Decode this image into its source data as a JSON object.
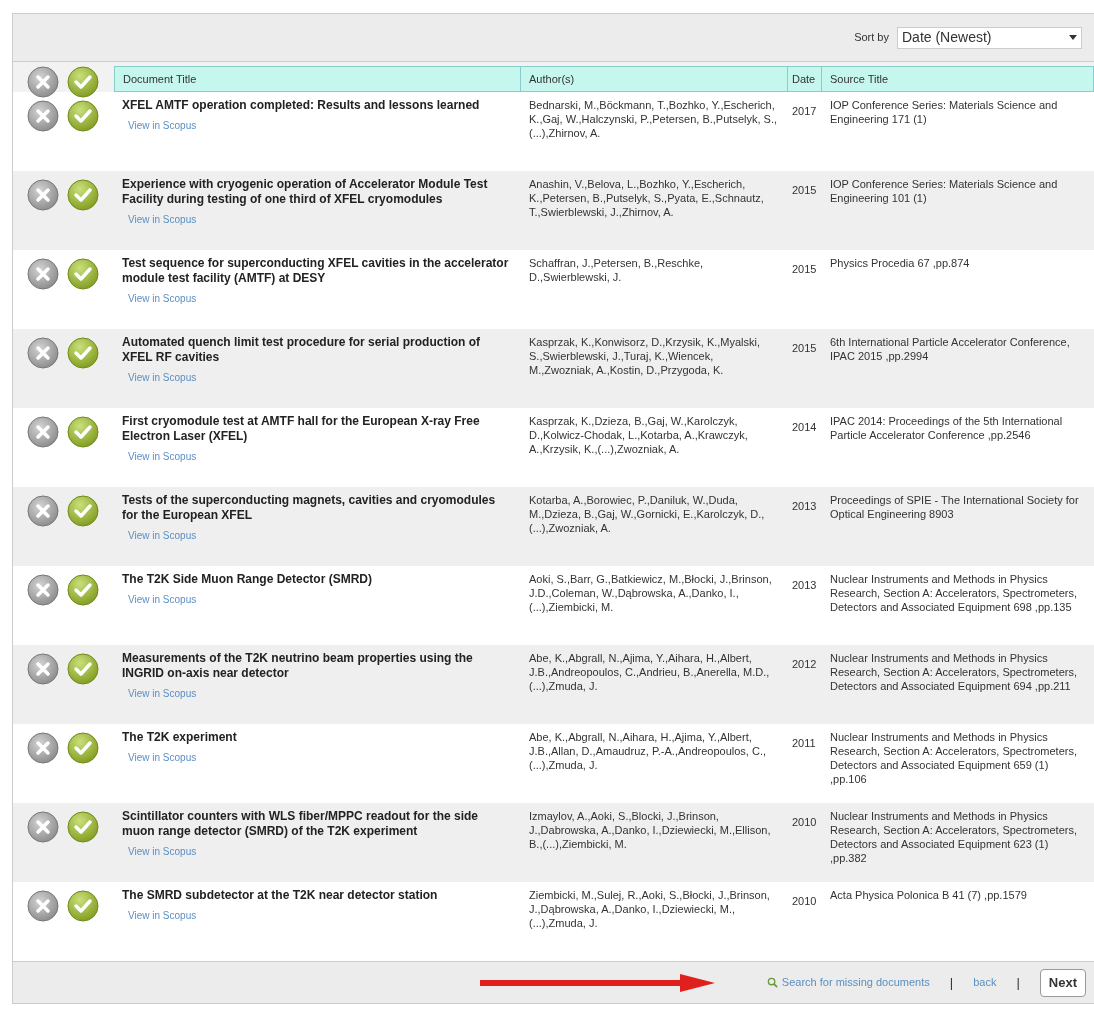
{
  "toolbar": {
    "sort_label": "Sort by",
    "sort_value": "Date (Newest)"
  },
  "table": {
    "columns": [
      "Document Title",
      "Author(s)",
      "Date",
      "Source Title"
    ],
    "rows": [
      {
        "title": "XFEL AMTF operation completed: Results and lessons learned",
        "link": "View in Scopus",
        "authors": "Bednarski, M.,Böckmann, T.,Bozhko, Y.,Escherich, K.,Gaj, W.,Halczynski, P.,Petersen, B.,Putselyk, S.,(...),Zhirnov, A.",
        "date": "2017",
        "source": "IOP Conference Series: Materials Science and Engineering 171 (1)"
      },
      {
        "title": "Experience with cryogenic operation of Accelerator Module Test Facility during testing of one third of XFEL cryomodules",
        "link": "View in Scopus",
        "authors": "Anashin, V.,Belova, L.,Bozhko, Y.,Escherich, K.,Petersen, B.,Putselyk, S.,Pyata, E.,Schnautz, T.,Swierblewski, J.,Zhirnov, A.",
        "date": "2015",
        "source": "IOP Conference Series: Materials Science and Engineering 101 (1)"
      },
      {
        "title": "Test sequence for superconducting XFEL cavities in the accelerator module test facility (AMTF) at DESY",
        "link": "View in Scopus",
        "authors": "Schaffran, J.,Petersen, B.,Reschke, D.,Swierblewski, J.",
        "date": "2015",
        "source": "Physics Procedia 67 ,pp.874"
      },
      {
        "title": "Automated quench limit test procedure for serial production of XFEL RF cavities",
        "link": "View in Scopus",
        "authors": "Kasprzak, K.,Konwisorz, D.,Krzysik, K.,Myalski, S.,Swierblewski, J.,Turaj, K.,Wiencek, M.,Zwozniak, A.,Kostin, D.,Przygoda, K.",
        "date": "2015",
        "source": "6th International Particle Accelerator Conference, IPAC 2015 ,pp.2994"
      },
      {
        "title": "First cryomodule test at AMTF hall for the European X-ray Free Electron Laser (XFEL)",
        "link": "View in Scopus",
        "authors": "Kasprzak, K.,Dzieza, B.,Gaj, W.,Karolczyk, D.,Kolwicz-Chodak, L.,Kotarba, A.,Krawczyk, A.,Krzysik, K.,(...),Zwozniak, A.",
        "date": "2014",
        "source": "IPAC 2014: Proceedings of the 5th International Particle Accelerator Conference ,pp.2546"
      },
      {
        "title": "Tests of the superconducting magnets, cavities and cryomodules for the European XFEL",
        "link": "View in Scopus",
        "authors": "Kotarba, A.,Borowiec, P.,Daniluk, W.,Duda, M.,Dzieza, B.,Gaj, W.,Gornicki, E.,Karolczyk, D.,(...),Zwozniak, A.",
        "date": "2013",
        "source": "Proceedings of SPIE - The International Society for Optical Engineering 8903"
      },
      {
        "title": "The T2K Side Muon Range Detector (SMRD)",
        "link": "View in Scopus",
        "authors": "Aoki, S.,Barr, G.,Batkiewicz, M.,Błocki, J.,Brinson, J.D.,Coleman, W.,Dąbrowska, A.,Danko, I.,(...),Ziembicki, M.",
        "date": "2013",
        "source": "Nuclear Instruments and Methods in Physics Research, Section A: Accelerators, Spectrometers, Detectors and Associated Equipment 698 ,pp.135"
      },
      {
        "title": "Measurements of the T2K neutrino beam properties using the INGRID on-axis near detector",
        "link": "View in Scopus",
        "authors": "Abe, K.,Abgrall, N.,Ajima, Y.,Aihara, H.,Albert, J.B.,Andreopoulos, C.,Andrieu, B.,Anerella, M.D.,(...),Zmuda, J.",
        "date": "2012",
        "source": "Nuclear Instruments and Methods in Physics Research, Section A: Accelerators, Spectrometers, Detectors and Associated Equipment 694 ,pp.211"
      },
      {
        "title": "The T2K experiment",
        "link": "View in Scopus",
        "authors": "Abe, K.,Abgrall, N.,Aihara, H.,Ajima, Y.,Albert, J.B.,Allan, D.,Amaudruz, P.-A.,Andreopoulos, C.,(...),Zmuda, J.",
        "date": "2011",
        "source": "Nuclear Instruments and Methods in Physics Research, Section A: Accelerators, Spectrometers, Detectors and Associated Equipment 659 (1) ,pp.106"
      },
      {
        "title": "Scintillator counters with WLS fiber/MPPC readout for the side muon range detector (SMRD) of the T2K experiment",
        "link": "View in Scopus",
        "authors": "Izmaylov, A.,Aoki, S.,Blocki, J.,Brinson, J.,Dabrowska, A.,Danko, I.,Dziewiecki, M.,Ellison, B.,(...),Ziembicki, M.",
        "date": "2010",
        "source": "Nuclear Instruments and Methods in Physics Research, Section A: Accelerators, Spectrometers, Detectors and Associated Equipment 623 (1) ,pp.382"
      },
      {
        "title": "The SMRD subdetector at the T2K near detector station",
        "link": "View in Scopus",
        "authors": "Ziembicki, M.,Sulej, R.,Aoki, S.,Błocki, J.,Brinson, J.,Dąbrowska, A.,Danko, I.,Dziewiecki, M.,(...),Zmuda, J.",
        "date": "2010",
        "source": "Acta Physica Polonica B 41 (7) ,pp.1579"
      }
    ]
  },
  "footer": {
    "search_link": "Search for missing documents",
    "separator_1": "|",
    "back_link": "back",
    "separator_2": "|",
    "next_button": "Next"
  }
}
